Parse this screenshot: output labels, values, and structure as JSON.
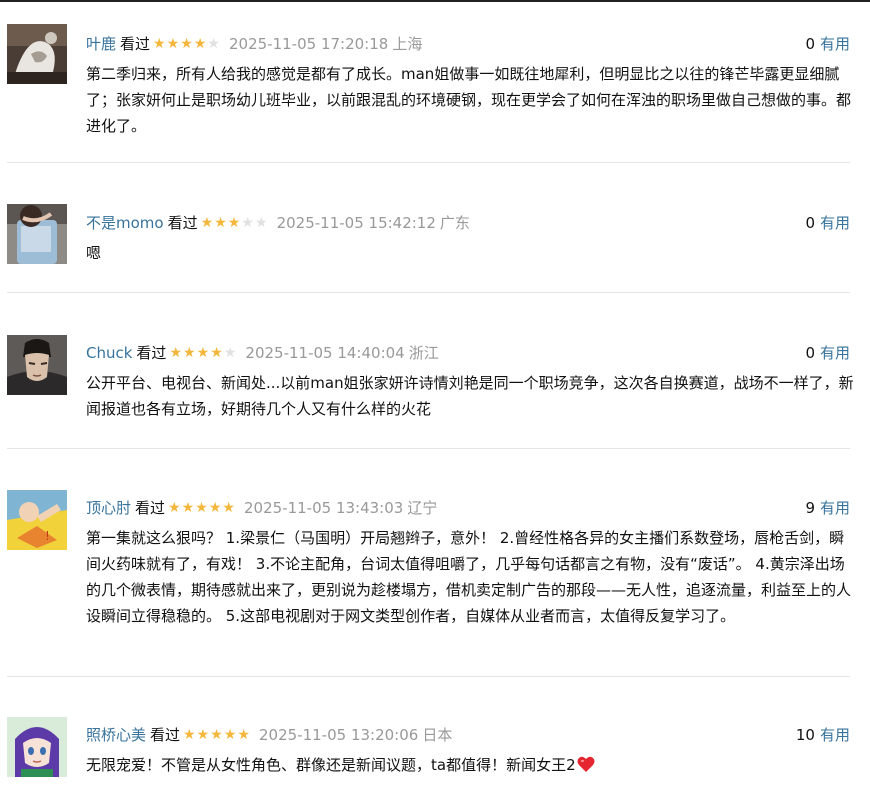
{
  "labels": {
    "watched": "看过",
    "useful": "有用"
  },
  "comments": [
    {
      "user": "叶鹿",
      "rating": 4,
      "time": "2025-11-05 17:20:18",
      "location": "上海",
      "votes": "0",
      "text": "第二季归来，所有人给我的感觉是都有了成长。man姐做事一如既往地犀利，但明显比之以往的锋芒毕露更显细腻了；张家妍何止是职场幼儿班毕业，以前跟混乱的环境硬钢，现在更学会了如何在浑浊的职场里做自己想做的事。都进化了。",
      "avatar_icon": "user-avatar-icon"
    },
    {
      "user": "不是momo",
      "rating": 3,
      "time": "2025-11-05 15:42:12",
      "location": "广东",
      "votes": "0",
      "text": "嗯",
      "avatar_icon": "user-avatar-icon"
    },
    {
      "user": "Chuck",
      "rating": 4,
      "time": "2025-11-05 14:40:04",
      "location": "浙江",
      "votes": "0",
      "text": "公开平台、电视台、新闻处...以前man姐张家妍许诗情刘艳是同一个职场竞争，这次各自换赛道，战场不一样了，新闻报道也各有立场，好期待几个人又有什么样的火花",
      "avatar_icon": "user-avatar-icon"
    },
    {
      "user": "顶心肘",
      "rating": 5,
      "time": "2025-11-05 13:43:03",
      "location": "辽宁",
      "votes": "9",
      "text": "第一集就这么狠吗？ 1.梁景仁（马国明）开局翘辫子，意外！ 2.曾经性格各异的女主播们系数登场，唇枪舌剑，瞬间火药味就有了，有戏！ 3.不论主配角，台词太值得咀嚼了，几乎每句话都言之有物，没有“废话”。 4.黄宗泽出场的几个微表情，期待感就出来了，更别说为趁楼塌方，借机卖定制广告的那段——无人性，追逐流量，利益至上的人设瞬间立得稳稳的。 5.这部电视剧对于网文类型创作者，自媒体从业者而言，太值得反复学习了。",
      "avatar_icon": "user-avatar-icon"
    },
    {
      "user": "照桥心美",
      "rating": 5,
      "time": "2025-11-05 13:20:06",
      "location": "日本",
      "votes": "10",
      "text": "无限宠爱！不管是从女性角色、群像还是新闻议题，ta都值得！新闻女王2",
      "avatar_icon": "user-avatar-icon",
      "emoji_icon": "red-heart-icon"
    }
  ]
}
